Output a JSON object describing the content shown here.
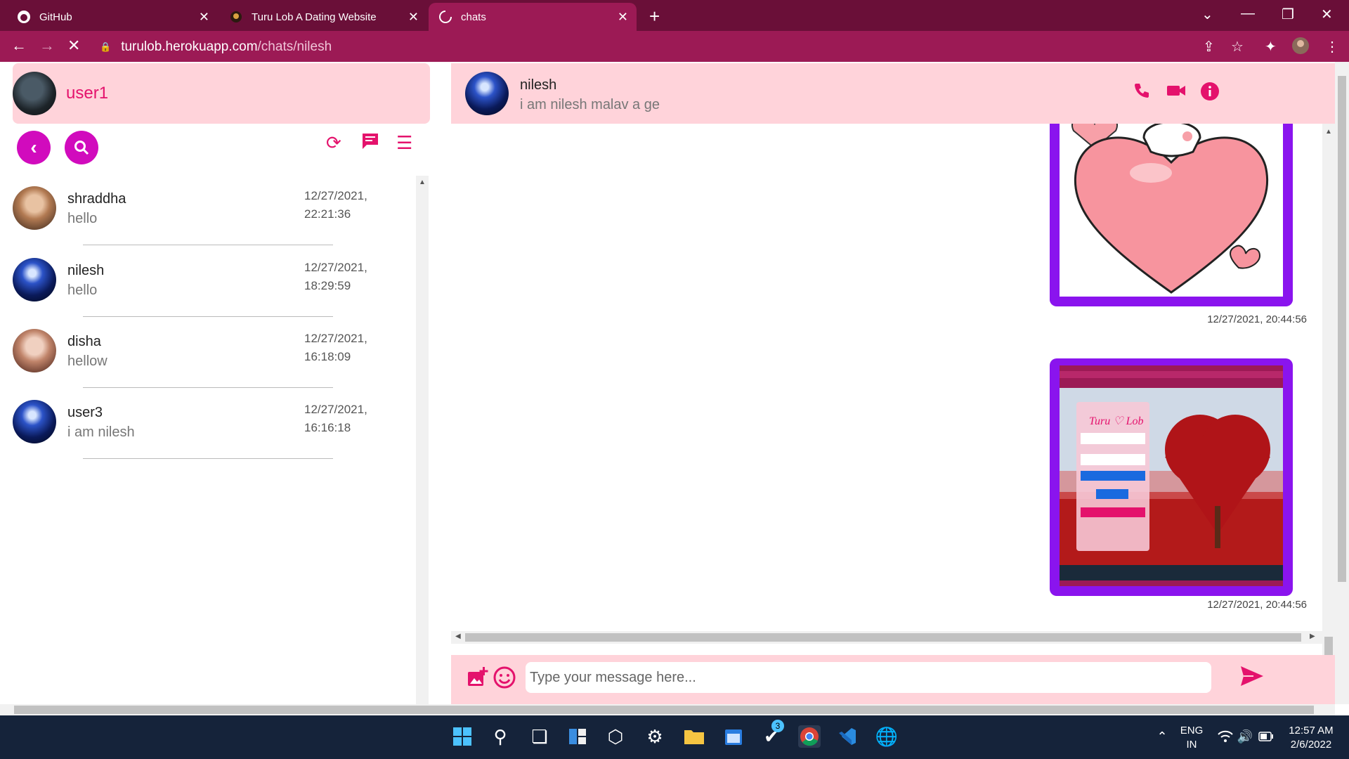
{
  "browser": {
    "tabs": [
      {
        "title": "GitHub",
        "icon": "github-icon"
      },
      {
        "title": "Turu Lob A Dating Website",
        "icon": "site-icon"
      },
      {
        "title": "chats",
        "icon": "loading-icon"
      }
    ],
    "url_host": "turulob.herokuapp.com",
    "url_path": "/chats/nilesh"
  },
  "sidebar": {
    "user_name": "user1",
    "chats": [
      {
        "name": "shraddha",
        "last": "hello",
        "date": "12/27/2021,",
        "time": "22:21:36"
      },
      {
        "name": "nilesh",
        "last": "hello",
        "date": "12/27/2021,",
        "time": "18:29:59"
      },
      {
        "name": "disha",
        "last": "hellow",
        "date": "12/27/2021,",
        "time": "16:18:09"
      },
      {
        "name": "user3",
        "last": "i am nilesh",
        "date": "12/27/2021,",
        "time": "16:16:18"
      }
    ]
  },
  "chat": {
    "name": "nilesh",
    "status": "i am nilesh malav a ge",
    "messages": [
      {
        "type": "image",
        "subject": "heart-sticker",
        "time": "12/27/2021, 20:44:56"
      },
      {
        "type": "image",
        "subject": "website-screenshot",
        "time": "12/27/2021, 20:44:56"
      }
    ],
    "screenshot_text": "Turu ♡ Lob",
    "composer_placeholder": "Type your message here..."
  },
  "taskbar": {
    "lang_top": "ENG",
    "lang_bottom": "IN",
    "time": "12:57 AM",
    "date": "2/6/2022",
    "badge": "3"
  },
  "colors": {
    "accent": "#e4126c",
    "purple": "#8a14ee",
    "pink_panel": "#ffd3da",
    "magenta_btn": "#d10bbd"
  }
}
